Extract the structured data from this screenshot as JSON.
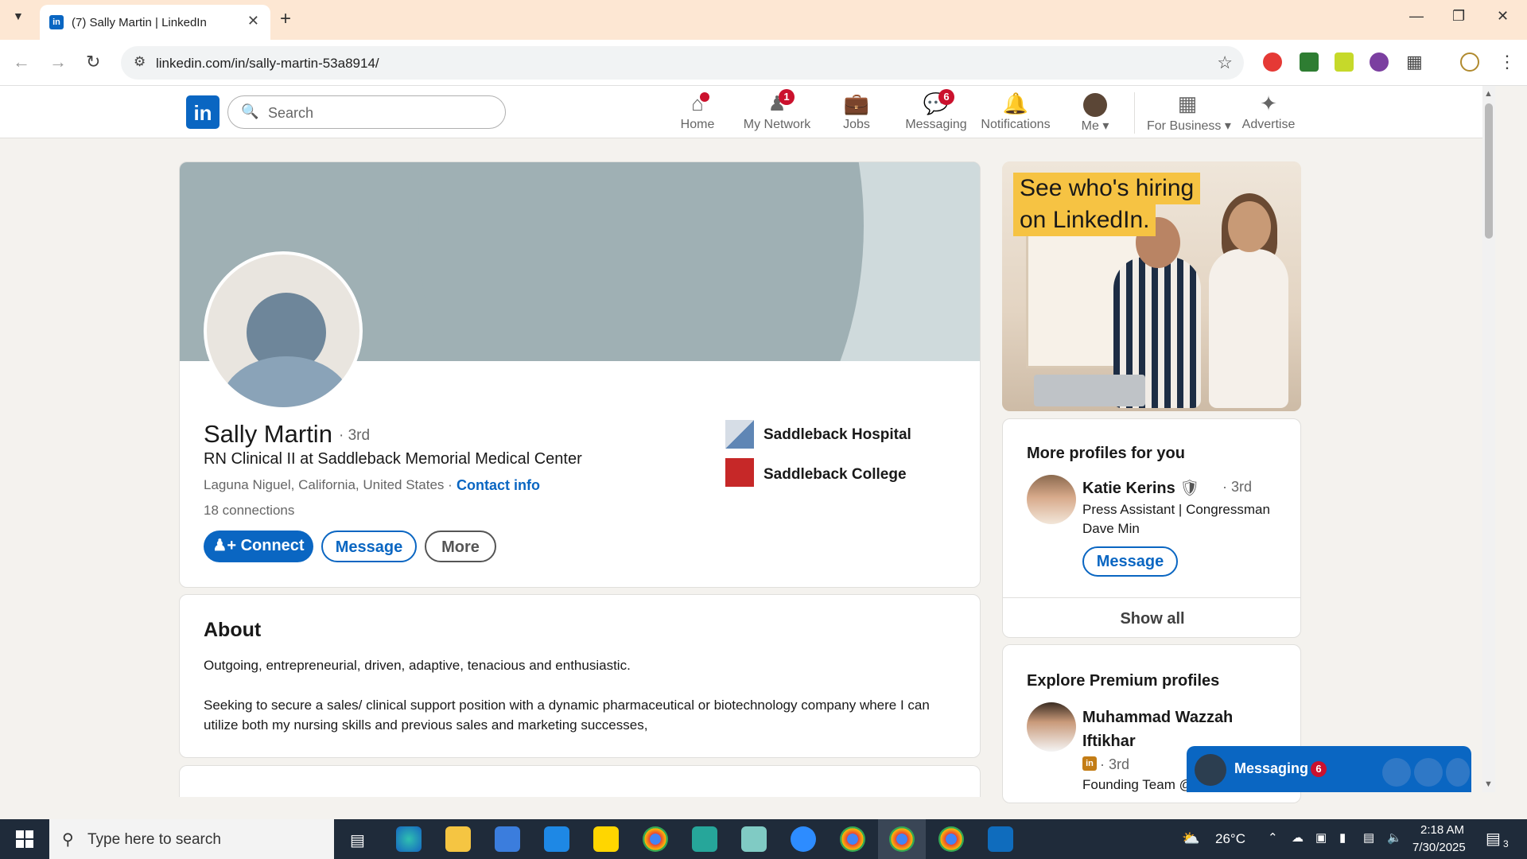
{
  "browser": {
    "tab_title": "(7) Sally Martin | LinkedIn",
    "url": "linkedin.com/in/sally-martin-53a8914/"
  },
  "linkedin": {
    "search_placeholder": "Search",
    "nav": [
      {
        "label": "Home",
        "icon": "home-icon",
        "badge": ""
      },
      {
        "label": "My Network",
        "icon": "people-icon",
        "badge": "1"
      },
      {
        "label": "Jobs",
        "icon": "briefcase-icon",
        "badge": ""
      },
      {
        "label": "Messaging",
        "icon": "chat-icon",
        "badge": "6"
      },
      {
        "label": "Notifications",
        "icon": "bell-icon",
        "badge": ""
      },
      {
        "label": "Me",
        "icon": "avatar",
        "badge": ""
      },
      {
        "label": "For Business",
        "icon": "grid-icon",
        "badge": ""
      },
      {
        "label": "Advertise",
        "icon": "advertise-icon",
        "badge": ""
      }
    ]
  },
  "profile": {
    "name": "Sally Martin",
    "degree": "· 3rd",
    "headline": "RN Clinical II at Saddleback Memorial Medical Center",
    "location": "Laguna Niguel, California, United States ·",
    "contact_info": "Contact info",
    "connections": "18 connections",
    "buttons": {
      "connect": "Connect",
      "message": "Message",
      "more": "More"
    },
    "orgs": [
      "Saddleback Hospital",
      "Saddleback College"
    ]
  },
  "about": {
    "title": "About",
    "paragraphs": [
      "Outgoing, entrepreneurial, driven, adaptive, tenacious and enthusiastic.",
      "Seeking to secure a sales/ clinical support position with a dynamic pharmaceutical or biotechnology company where I can utilize both my nursing skills and previous sales and marketing successes,"
    ]
  },
  "ad": {
    "line1": "See who's hiring",
    "line2": "on LinkedIn."
  },
  "more_profiles": {
    "title": "More profiles for you",
    "person": {
      "name": "Katie Kerins",
      "degree": "· 3rd",
      "description": "Press Assistant | Congressman Dave Min",
      "button": "Message"
    },
    "show_all": "Show all"
  },
  "premium": {
    "title": "Explore Premium profiles",
    "person": {
      "name": "Muhammad Wazzah Iftikhar",
      "degree": "· 3rd",
      "description": "Founding Team @"
    }
  },
  "messaging_bar": {
    "label": "Messaging",
    "count": "6"
  },
  "taskbar": {
    "search_placeholder": "Type here to search",
    "weather": "26°C",
    "time": "2:18 AM",
    "date": "7/30/2025",
    "notifications": "3"
  }
}
